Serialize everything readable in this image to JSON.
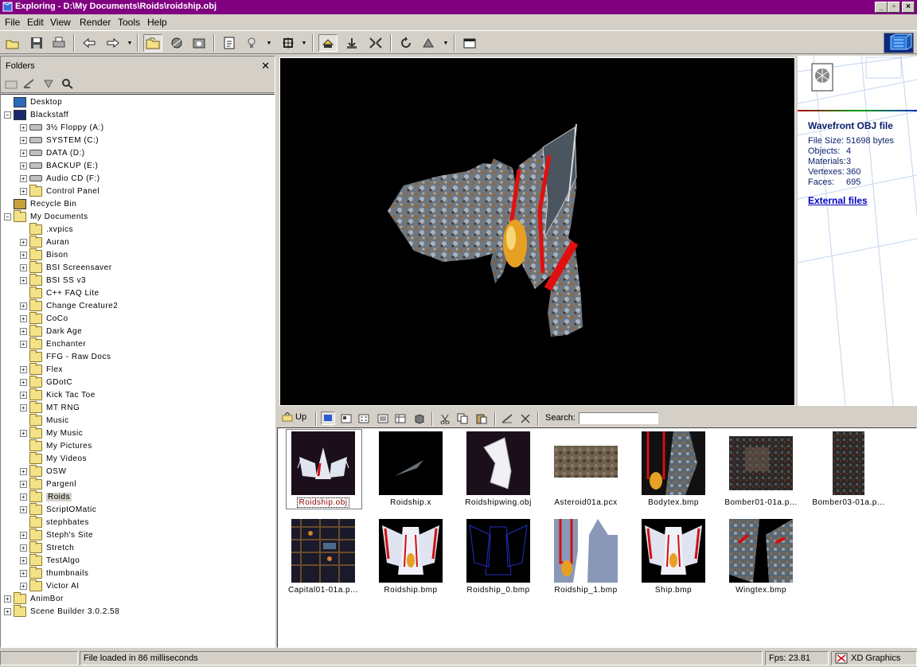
{
  "window": {
    "title": "Exploring - D:\\My Documents\\Roids\\roidship.obj"
  },
  "menu": [
    "File",
    "Edit",
    "View",
    "Render",
    "Tools",
    "Help"
  ],
  "toolbar_icons": [
    "open-icon",
    "save-icon",
    "print-icon",
    "back-icon",
    "forward-icon",
    "dropdown-icon",
    "folders-icon",
    "render-icon",
    "capture-icon",
    "properties-icon",
    "light-icon",
    "dropdown-icon",
    "fit-icon",
    "dropdown-icon",
    "move-icon",
    "rotate-icon",
    "zoom-icon",
    "refresh-icon",
    "animate-icon",
    "dropdown-icon",
    "fullscreen-icon"
  ],
  "folders": {
    "title": "Folders",
    "close": "✕",
    "tree": [
      {
        "label": "Desktop",
        "depth": 0,
        "expander": "",
        "icon": "desktop-icon"
      },
      {
        "label": "Blackstaff",
        "depth": 0,
        "expander": "−",
        "icon": "computer-icon"
      },
      {
        "label": "3½ Floppy (A:)",
        "depth": 1,
        "expander": "+",
        "icon": "floppy-icon"
      },
      {
        "label": "SYSTEM (C:)",
        "depth": 1,
        "expander": "+",
        "icon": "drive-icon"
      },
      {
        "label": "DATA (D:)",
        "depth": 1,
        "expander": "+",
        "icon": "drive-icon"
      },
      {
        "label": "BACKUP (E:)",
        "depth": 1,
        "expander": "+",
        "icon": "drive-icon"
      },
      {
        "label": "Audio CD (F:)",
        "depth": 1,
        "expander": "+",
        "icon": "cd-icon"
      },
      {
        "label": "Control Panel",
        "depth": 1,
        "expander": "+",
        "icon": "control-panel-icon"
      },
      {
        "label": "Recycle Bin",
        "depth": 0,
        "expander": "",
        "icon": "recycle-bin-icon"
      },
      {
        "label": "My Documents",
        "depth": 0,
        "expander": "−",
        "icon": "folder-open-icon"
      },
      {
        "label": ".xvpics",
        "depth": 1,
        "expander": "",
        "icon": "folder-icon"
      },
      {
        "label": "Auran",
        "depth": 1,
        "expander": "+",
        "icon": "folder-icon"
      },
      {
        "label": "Bison",
        "depth": 1,
        "expander": "+",
        "icon": "folder-icon"
      },
      {
        "label": "BSI Screensaver",
        "depth": 1,
        "expander": "+",
        "icon": "folder-icon"
      },
      {
        "label": "BSI SS v3",
        "depth": 1,
        "expander": "+",
        "icon": "folder-icon"
      },
      {
        "label": "C++ FAQ Lite",
        "depth": 1,
        "expander": "",
        "icon": "folder-icon"
      },
      {
        "label": "Change Creature2",
        "depth": 1,
        "expander": "+",
        "icon": "folder-icon"
      },
      {
        "label": "CoCo",
        "depth": 1,
        "expander": "+",
        "icon": "folder-icon"
      },
      {
        "label": "Dark Age",
        "depth": 1,
        "expander": "+",
        "icon": "folder-icon"
      },
      {
        "label": "Enchanter",
        "depth": 1,
        "expander": "+",
        "icon": "folder-icon"
      },
      {
        "label": "FFG - Raw Docs",
        "depth": 1,
        "expander": "",
        "icon": "folder-icon"
      },
      {
        "label": "Flex",
        "depth": 1,
        "expander": "+",
        "icon": "folder-icon"
      },
      {
        "label": "GDotC",
        "depth": 1,
        "expander": "+",
        "icon": "folder-icon"
      },
      {
        "label": "Kick Tac Toe",
        "depth": 1,
        "expander": "+",
        "icon": "folder-icon"
      },
      {
        "label": "MT RNG",
        "depth": 1,
        "expander": "+",
        "icon": "folder-icon"
      },
      {
        "label": "Music",
        "depth": 1,
        "expander": "",
        "icon": "folder-icon"
      },
      {
        "label": "My Music",
        "depth": 1,
        "expander": "+",
        "icon": "folder-icon"
      },
      {
        "label": "My Pictures",
        "depth": 1,
        "expander": "",
        "icon": "pictures-folder-icon"
      },
      {
        "label": "My Videos",
        "depth": 1,
        "expander": "",
        "icon": "folder-icon"
      },
      {
        "label": "OSW",
        "depth": 1,
        "expander": "+",
        "icon": "folder-icon"
      },
      {
        "label": "Pargenl",
        "depth": 1,
        "expander": "+",
        "icon": "folder-icon"
      },
      {
        "label": "Roids",
        "depth": 1,
        "expander": "+",
        "icon": "folder-open-icon",
        "selected": true
      },
      {
        "label": "ScriptOMatic",
        "depth": 1,
        "expander": "+",
        "icon": "folder-icon"
      },
      {
        "label": "stephbates",
        "depth": 1,
        "expander": "",
        "icon": "folder-icon"
      },
      {
        "label": "Steph's Site",
        "depth": 1,
        "expander": "+",
        "icon": "folder-icon"
      },
      {
        "label": "Stretch",
        "depth": 1,
        "expander": "+",
        "icon": "folder-icon"
      },
      {
        "label": "TestAlgo",
        "depth": 1,
        "expander": "+",
        "icon": "folder-icon"
      },
      {
        "label": "thumbnails",
        "depth": 1,
        "expander": "+",
        "icon": "folder-icon"
      },
      {
        "label": "Victor AI",
        "depth": 1,
        "expander": "+",
        "icon": "folder-icon"
      },
      {
        "label": "AnimBor",
        "depth": 0,
        "expander": "+",
        "icon": "folder-icon"
      },
      {
        "label": "Scene Builder 3.0.2.58",
        "depth": 0,
        "expander": "+",
        "icon": "folder-icon"
      }
    ]
  },
  "info": {
    "file_type": "Wavefront OBJ file",
    "rows": [
      {
        "label": "File Size:",
        "value": "51698 bytes"
      },
      {
        "label": "Objects:",
        "value": "4"
      },
      {
        "label": "Materials:",
        "value": "3"
      },
      {
        "label": "Vertexes:",
        "value": "360"
      },
      {
        "label": "Faces:",
        "value": "695"
      }
    ],
    "link": "External files"
  },
  "browser": {
    "up_label": "Up",
    "search_label": "Search:",
    "search_value": "",
    "files": [
      {
        "name": "Roidship.obj",
        "kind": "ship",
        "selected": true
      },
      {
        "name": "Roidship.x",
        "kind": "sliver"
      },
      {
        "name": "Roidshipwing.obj",
        "kind": "wing"
      },
      {
        "name": "Asteroid01a.pcx",
        "kind": "rock"
      },
      {
        "name": "Bodytex.bmp",
        "kind": "bodytex"
      },
      {
        "name": "Bomber01-01a.p...",
        "kind": "bomber"
      },
      {
        "name": "Bomber03-01a.p...",
        "kind": "bomber2"
      },
      {
        "name": "Capital01-01a.p...",
        "kind": "capital"
      },
      {
        "name": "Roidship.bmp",
        "kind": "shipbmp"
      },
      {
        "name": "Roidship_0.bmp",
        "kind": "outline"
      },
      {
        "name": "Roidship_1.bmp",
        "kind": "grey"
      },
      {
        "name": "Ship.bmp",
        "kind": "shipbmp"
      },
      {
        "name": "Wingtex.bmp",
        "kind": "wingtex"
      }
    ]
  },
  "status": {
    "message": "File loaded in 86 milliseconds",
    "fps": "Fps: 23.81",
    "renderer": "XD Graphics"
  }
}
